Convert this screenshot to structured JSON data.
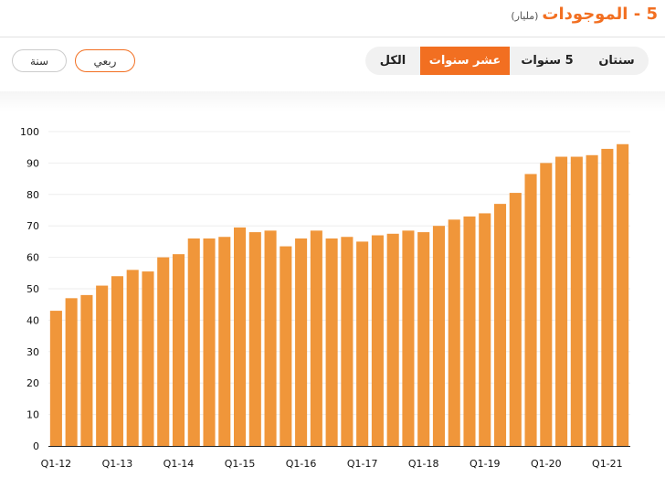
{
  "header": {
    "title": "5 - الموجودات",
    "unit": "(مليار)"
  },
  "tabs": [
    {
      "label": "سنتان",
      "active": false
    },
    {
      "label": "5 سنوات",
      "active": false
    },
    {
      "label": "عشر سنوات",
      "active": true
    },
    {
      "label": "الكل",
      "active": false
    }
  ],
  "period_toggle": {
    "quarterly_label": "ربعي",
    "annual_label": "سنة",
    "selected": "ربعي"
  },
  "colors": {
    "accent": "#f26f21",
    "bar": "#f0963a",
    "tab_bg": "#f1f1f1"
  },
  "chart_data": {
    "type": "bar",
    "title": "",
    "xlabel": "",
    "ylabel": "",
    "ylim": [
      0,
      100
    ],
    "yticks": [
      0,
      10,
      20,
      30,
      40,
      50,
      60,
      70,
      80,
      90,
      100
    ],
    "grid": true,
    "legend": "none",
    "categories": [
      "Q1-12",
      "Q2-12",
      "Q3-12",
      "Q4-12",
      "Q1-13",
      "Q2-13",
      "Q3-13",
      "Q4-13",
      "Q1-14",
      "Q2-14",
      "Q3-14",
      "Q4-14",
      "Q1-15",
      "Q2-15",
      "Q3-15",
      "Q4-15",
      "Q1-16",
      "Q2-16",
      "Q3-16",
      "Q4-16",
      "Q1-17",
      "Q2-17",
      "Q3-17",
      "Q4-17",
      "Q1-18",
      "Q2-18",
      "Q3-18",
      "Q4-18",
      "Q1-19",
      "Q2-19",
      "Q3-19",
      "Q4-19",
      "Q1-20",
      "Q2-20",
      "Q3-20",
      "Q4-20",
      "Q1-21",
      "Q2-21"
    ],
    "xtick_labels": [
      "Q1-12",
      "Q1-13",
      "Q1-14",
      "Q1-15",
      "Q1-16",
      "Q1-17",
      "Q1-18",
      "Q1-19",
      "Q1-20",
      "Q1-21"
    ],
    "values": [
      43,
      47,
      48,
      51,
      54,
      56,
      55.5,
      60,
      61,
      66,
      66,
      66.5,
      69.5,
      68,
      68.5,
      63.5,
      66,
      68.5,
      66,
      66.5,
      65,
      67,
      67.5,
      68.5,
      68,
      70,
      72,
      73,
      74,
      77,
      80.5,
      86.5,
      90,
      92,
      92,
      92.5,
      94.5,
      96
    ]
  }
}
